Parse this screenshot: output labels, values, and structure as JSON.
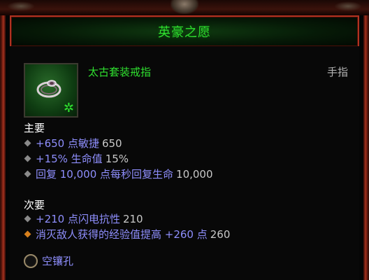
{
  "tooltip": {
    "title": "英豪之愿",
    "item_name": "太古套装戒指",
    "item_slot": "手指",
    "set_mark": "✲",
    "icon": "ring-icon",
    "primary": {
      "label": "主要",
      "stats": [
        {
          "text": "+650 点敏捷",
          "value": "650"
        },
        {
          "text": "+15% 生命值",
          "value": "15%"
        },
        {
          "text": "回复 10,000 点每秒回复生命",
          "value": "10,000"
        }
      ]
    },
    "secondary": {
      "label": "次要",
      "stats": [
        {
          "text": "+210 点闪电抗性",
          "value": "210"
        },
        {
          "text": "消灭敌人获得的经验值提高 +260 点",
          "value": "260"
        }
      ]
    },
    "socket": {
      "text": "空镶孔"
    }
  },
  "colors": {
    "set_green": "#2fe02f",
    "magic_blue": "#8e8efc",
    "value_gray": "#c8c8c8",
    "frame_red": "#b03220",
    "legendary_orange": "#d8801c"
  }
}
